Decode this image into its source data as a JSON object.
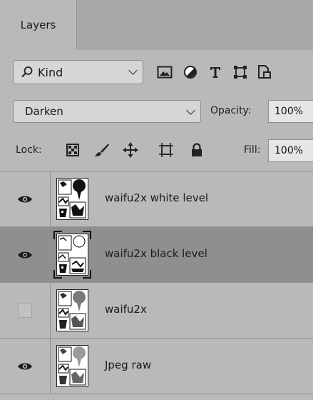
{
  "panel": {
    "tab_label": "Layers"
  },
  "filter": {
    "kind_label": "Kind",
    "icons": [
      "search-icon",
      "pixel-filter-icon",
      "adjustment-filter-icon",
      "type-filter-icon",
      "shape-filter-icon",
      "smart-object-filter-icon"
    ]
  },
  "blend": {
    "mode": "Darken",
    "opacity_label": "Opacity:",
    "opacity_value": "100%"
  },
  "lock": {
    "label": "Lock:",
    "icons": [
      "lock-transparent-icon",
      "lock-image-icon",
      "lock-position-icon",
      "lock-artboard-icon",
      "lock-all-icon"
    ],
    "fill_label": "Fill:",
    "fill_value": "100%"
  },
  "layers": [
    {
      "name": "waifu2x white level",
      "visible": true,
      "selected": false
    },
    {
      "name": "waifu2x black level",
      "visible": true,
      "selected": true
    },
    {
      "name": "waifu2x",
      "visible": false,
      "selected": false
    },
    {
      "name": "Jpeg raw",
      "visible": true,
      "selected": false
    }
  ],
  "colors": {
    "panel_bg": "#b9b9b9",
    "tabbar_bg": "#a9a9a9",
    "selected_row": "#8f8f8f",
    "divider": "#8f8f8f"
  }
}
